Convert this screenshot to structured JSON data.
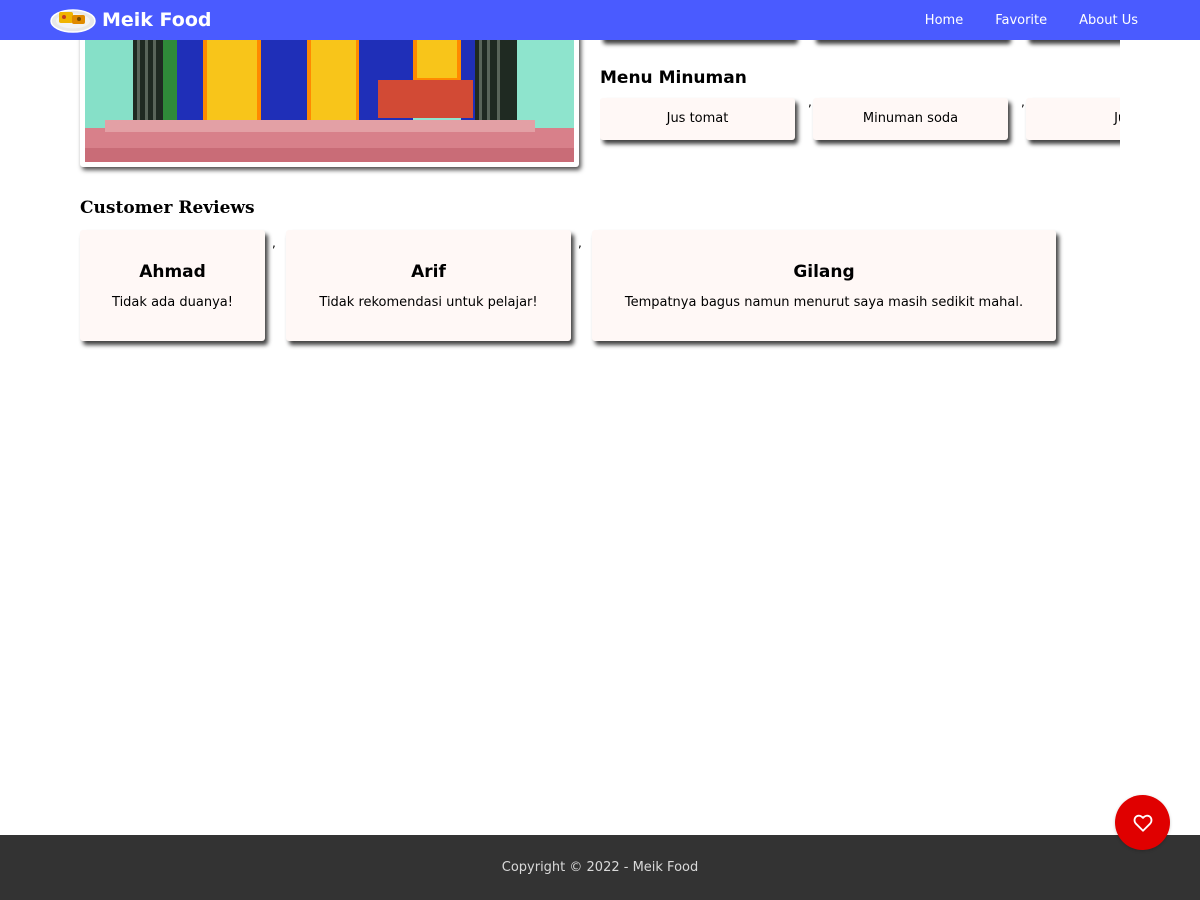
{
  "navbar": {
    "brand": "Meik Food",
    "links": [
      {
        "label": "Home"
      },
      {
        "label": "Favorite"
      },
      {
        "label": "About Us"
      }
    ]
  },
  "menu_minuman": {
    "title": "Menu Minuman",
    "items": [
      "Jus tomat",
      "Minuman soda",
      "Jus"
    ]
  },
  "reviews": {
    "title": "Customer Reviews",
    "items": [
      {
        "name": "Ahmad",
        "text": "Tidak ada duanya!"
      },
      {
        "name": "Arif",
        "text": "Tidak rekomendasi untuk pelajar!"
      },
      {
        "name": "Gilang",
        "text": "Tempatnya bagus namun menurut saya masih sedikit mahal."
      }
    ],
    "separator": ","
  },
  "footer": {
    "copyright": "Copyright © 2022 - Meik Food"
  },
  "colors": {
    "navbar": "#4a5bff",
    "card": "#fff8f6",
    "fab": "#e00000",
    "footer": "#333333"
  },
  "icons": {
    "logo": "food-plate-logo",
    "fab": "heart-outline-icon"
  }
}
